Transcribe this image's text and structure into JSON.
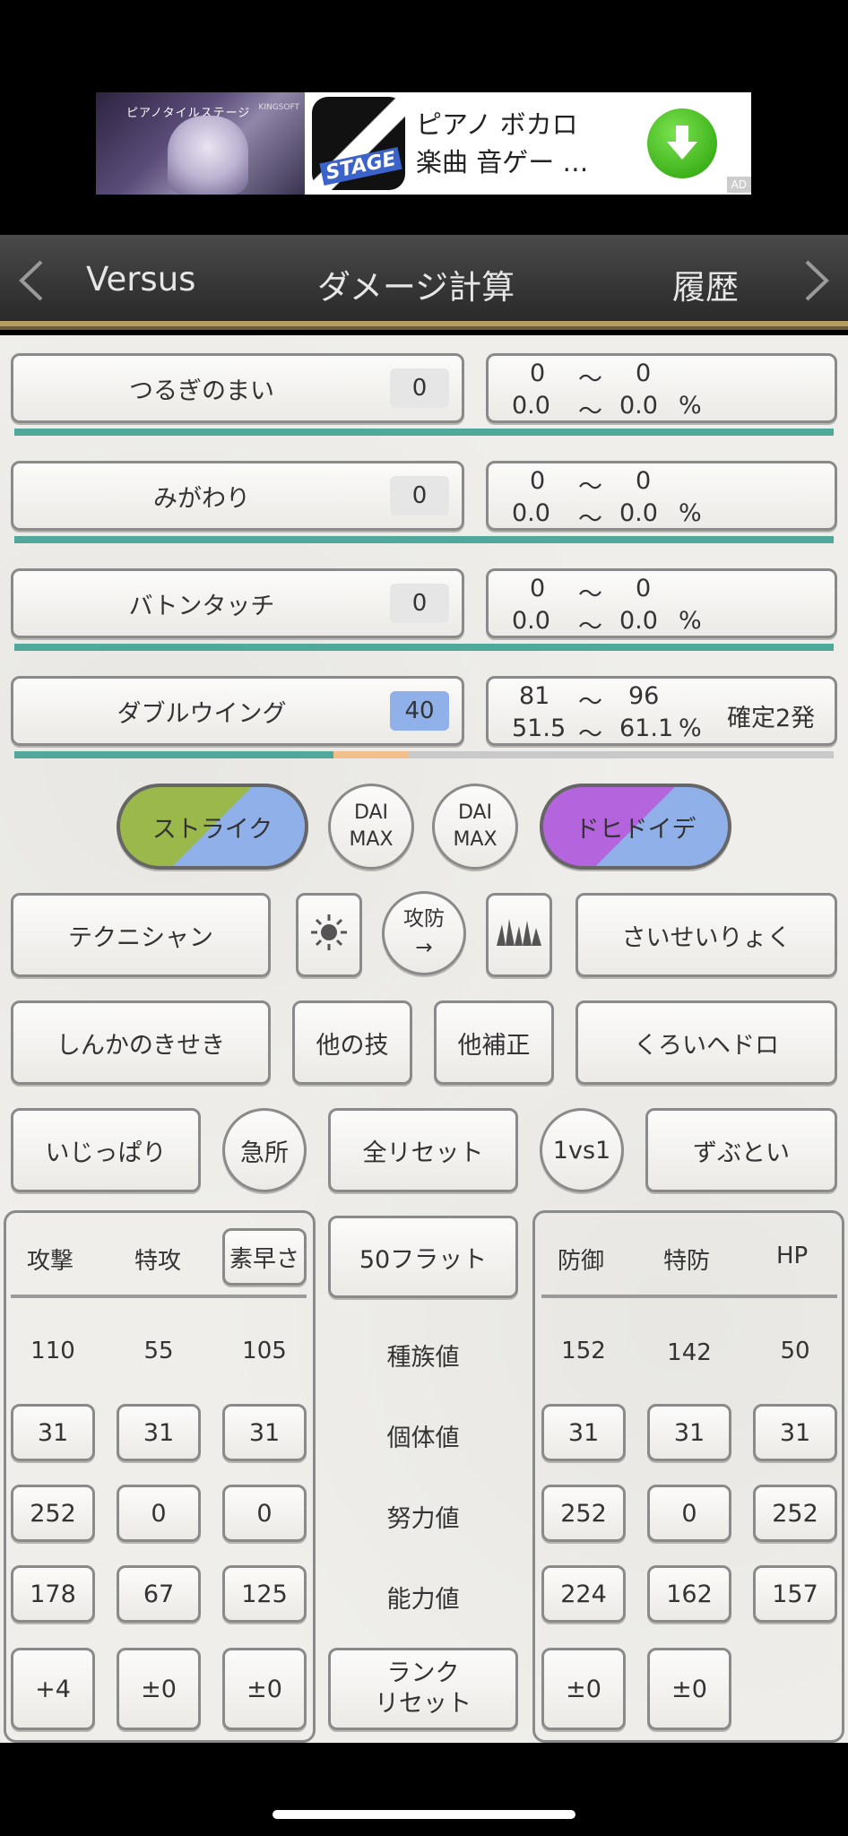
{
  "ad": {
    "thumb_title": "ピアノタイルステージ",
    "thumb_brand": "KINGSOFT",
    "app_icon_text": "STAGE",
    "line1": "ピアノ ボカロ",
    "line2": "楽曲 音ゲー …",
    "badge": "AD",
    "icon": "download-arrow-icon"
  },
  "nav": {
    "left": "Versus",
    "title": "ダメージ計算",
    "right": "履歴"
  },
  "moves": [
    {
      "name": "つるぎのまい",
      "power": "0",
      "dmg_min": "0",
      "dmg_max": "0",
      "pct_min": "0.0",
      "pct_max": "0.0",
      "verdict": ""
    },
    {
      "name": "みがわり",
      "power": "0",
      "dmg_min": "0",
      "dmg_max": "0",
      "pct_min": "0.0",
      "pct_max": "0.0",
      "verdict": ""
    },
    {
      "name": "バトンタッチ",
      "power": "0",
      "dmg_min": "0",
      "dmg_max": "0",
      "pct_min": "0.0",
      "pct_max": "0.0",
      "verdict": ""
    },
    {
      "name": "ダブルウイング",
      "power": "40",
      "dmg_min": "81",
      "dmg_max": "96",
      "pct_min": "51.5",
      "pct_max": "61.1",
      "verdict": "確定2発"
    }
  ],
  "tilde": "〜",
  "percent": "%",
  "hp_bar": {
    "remaining_pct": 38.9,
    "range_pct": 9.2
  },
  "types": {
    "attacker": "ストライク",
    "dmax1_a": "DAI",
    "dmax1_b": "MAX",
    "dmax2_a": "DAI",
    "dmax2_b": "MAX",
    "defender": "ドヒドイデ"
  },
  "row2": {
    "ability_left": "テクニシャン",
    "weather_icon": "sun-icon",
    "swap_a": "攻防",
    "swap_b": "→",
    "terrain_icon": "grass-icon",
    "ability_right": "さいせいりょく"
  },
  "row3": {
    "item_left": "しんかのきせき",
    "other_move": "他の技",
    "other_mod": "他補正",
    "item_right": "くろいヘドロ"
  },
  "row4": {
    "nature_left": "いじっぱり",
    "crit": "急所",
    "reset_all": "全リセット",
    "mode": "1vs1",
    "nature_right": "ずぶとい"
  },
  "stats": {
    "atk_headers": [
      "攻撃",
      "特攻",
      "素早さ"
    ],
    "def_headers": [
      "防御",
      "特防",
      "HP"
    ],
    "flat50": "50フラット",
    "row_labels": [
      "種族値",
      "個体値",
      "努力値",
      "能力値"
    ],
    "rank_reset_a": "ランク",
    "rank_reset_b": "リセット",
    "atk_base": [
      "110",
      "55",
      "105"
    ],
    "atk_iv": [
      "31",
      "31",
      "31"
    ],
    "atk_ev": [
      "252",
      "0",
      "0"
    ],
    "atk_stat": [
      "178",
      "67",
      "125"
    ],
    "atk_rank": [
      "+4",
      "±0",
      "±0"
    ],
    "def_base": [
      "152",
      "142",
      "50"
    ],
    "def_iv": [
      "31",
      "31",
      "31"
    ],
    "def_ev": [
      "252",
      "0",
      "252"
    ],
    "def_stat": [
      "224",
      "162",
      "157"
    ],
    "def_rank": [
      "±0",
      "±0"
    ]
  },
  "colors": {
    "bug_green": "#9bb84a",
    "water_blue": "#8fb0e8",
    "poison_purple": "#b464dc",
    "hp_green": "#4fa89a",
    "hp_orange": "#f2be8a"
  }
}
